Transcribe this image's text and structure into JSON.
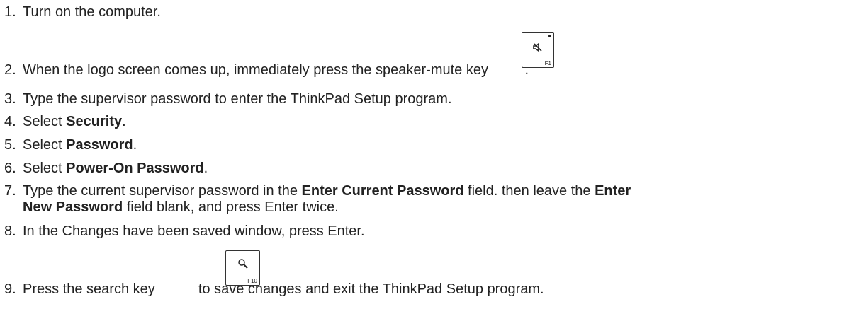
{
  "steps": [
    {
      "num": "1.",
      "text": "Turn on the computer."
    },
    {
      "num": "2.",
      "pre": "When the logo screen comes up, immediately press the speaker-mute key ",
      "post": ".",
      "key_icon": "speaker-mute-icon",
      "key_label": "F1"
    },
    {
      "num": "3.",
      "text": "Type the supervisor password to enter the ThinkPad Setup program."
    },
    {
      "num": "4.",
      "pre": "Select ",
      "bold": "Security",
      "post": "."
    },
    {
      "num": "5.",
      "pre": "Select ",
      "bold": "Password",
      "post": "."
    },
    {
      "num": "6.",
      "pre": "Select ",
      "bold": "Power-On Password",
      "post": "."
    },
    {
      "num": "7.",
      "pre": "Type the current supervisor password in the ",
      "bold1": "Enter Current Password",
      "mid": " field. then leave the ",
      "bold2a": "Enter",
      "bold2b": "New Password",
      "post": " field blank, and press Enter twice."
    },
    {
      "num": "8.",
      "text": "In the Changes have been saved window, press Enter."
    },
    {
      "num": "9.",
      "pre": "Press the search key ",
      "post": " to save changes and exit the ThinkPad Setup program.",
      "key_icon": "search-icon",
      "key_label": "F10"
    }
  ]
}
